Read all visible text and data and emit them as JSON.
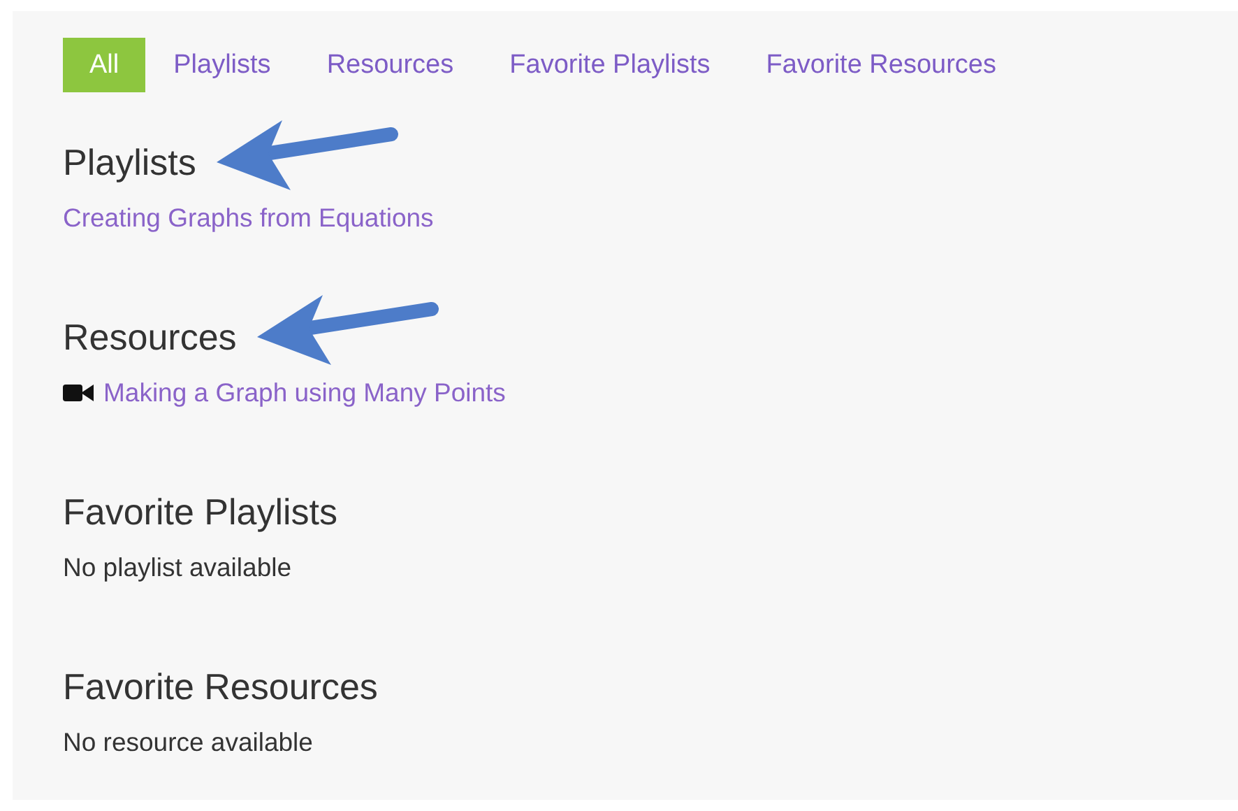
{
  "tabs": [
    {
      "label": "All",
      "selected": true
    },
    {
      "label": "Playlists",
      "selected": false
    },
    {
      "label": "Resources",
      "selected": false
    },
    {
      "label": "Favorite Playlists",
      "selected": false
    },
    {
      "label": "Favorite Resources",
      "selected": false
    }
  ],
  "sections": [
    {
      "heading": "Playlists",
      "annotation_arrow": true,
      "items": [
        {
          "kind": "link",
          "text": "Creating Graphs from Equations"
        }
      ]
    },
    {
      "heading": "Resources",
      "annotation_arrow": true,
      "items": [
        {
          "kind": "video_link",
          "text": "Making a Graph using Many Points"
        }
      ]
    },
    {
      "heading": "Favorite Playlists",
      "annotation_arrow": false,
      "items": [
        {
          "kind": "empty",
          "text": "No playlist available"
        }
      ]
    },
    {
      "heading": "Favorite Resources",
      "annotation_arrow": false,
      "items": [
        {
          "kind": "empty",
          "text": "No resource available"
        }
      ]
    }
  ]
}
